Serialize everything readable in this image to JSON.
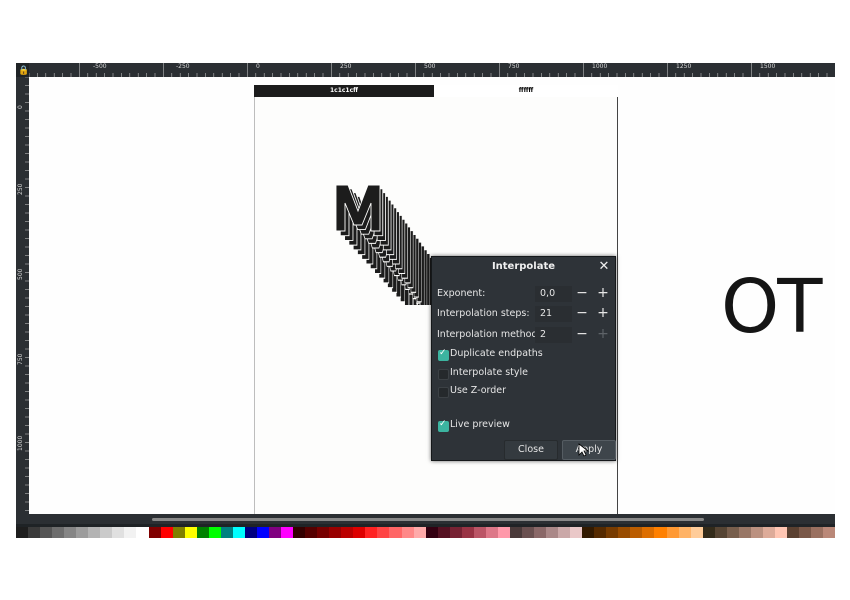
{
  "tabs": {
    "left": "1c1c1cff",
    "right": "ffffff"
  },
  "ruler": {
    "labels": [
      "-500",
      "-250",
      "0",
      "250",
      "500",
      "750",
      "1000",
      "1250",
      "1500"
    ],
    "vlabels": [
      "0",
      "250",
      "500",
      "750",
      "1000"
    ]
  },
  "canvas_text": "OT",
  "dialog": {
    "title": "Interpolate",
    "close_icon": "close-icon",
    "exponent_label": "Exponent:",
    "exponent_value": "0,0",
    "steps_label": "Interpolation steps:",
    "steps_value": "21",
    "method_label": "Interpolation method:",
    "method_value": "2",
    "duplicate_endpaths": "Duplicate endpaths",
    "interpolate_style": "Interpolate style",
    "use_zorder": "Use Z-order",
    "live_preview": "Live preview",
    "close_button": "Close",
    "apply_button": "Apply",
    "checks": {
      "duplicate_endpaths": true,
      "interpolate_style": false,
      "use_zorder": false,
      "live_preview": true
    }
  },
  "palette": [
    "#1e1e1e",
    "#3a3a3a",
    "#555555",
    "#6d6d6d",
    "#858585",
    "#9c9c9c",
    "#b3b3b3",
    "#cacaca",
    "#e0e0e0",
    "#f2f2f2",
    "#ffffff",
    "#800000",
    "#ff0000",
    "#808000",
    "#ffff00",
    "#008000",
    "#00ff00",
    "#008080",
    "#00ffff",
    "#000080",
    "#0000ff",
    "#800080",
    "#ff00ff",
    "#330000",
    "#550000",
    "#770000",
    "#990000",
    "#bb0000",
    "#dd0000",
    "#ff2222",
    "#ff4444",
    "#ff6666",
    "#ff8888",
    "#ffaaaa",
    "#330011",
    "#551122",
    "#772233",
    "#993344",
    "#bb5566",
    "#dd7788",
    "#ff99aa",
    "#4a3a3a",
    "#6a5050",
    "#8a6868",
    "#aa8888",
    "#caa8a8",
    "#eac8c8",
    "#331a00",
    "#552a00",
    "#773b00",
    "#994c00",
    "#bb5d00",
    "#dd6e00",
    "#ff8000",
    "#ff9933",
    "#ffb366",
    "#ffcc99",
    "#332b1a",
    "#554433",
    "#775e4c",
    "#997766",
    "#bb9180",
    "#ddab99",
    "#ffc6b3",
    "#5a4030",
    "#7a5848",
    "#9a7060",
    "#ba8878"
  ]
}
